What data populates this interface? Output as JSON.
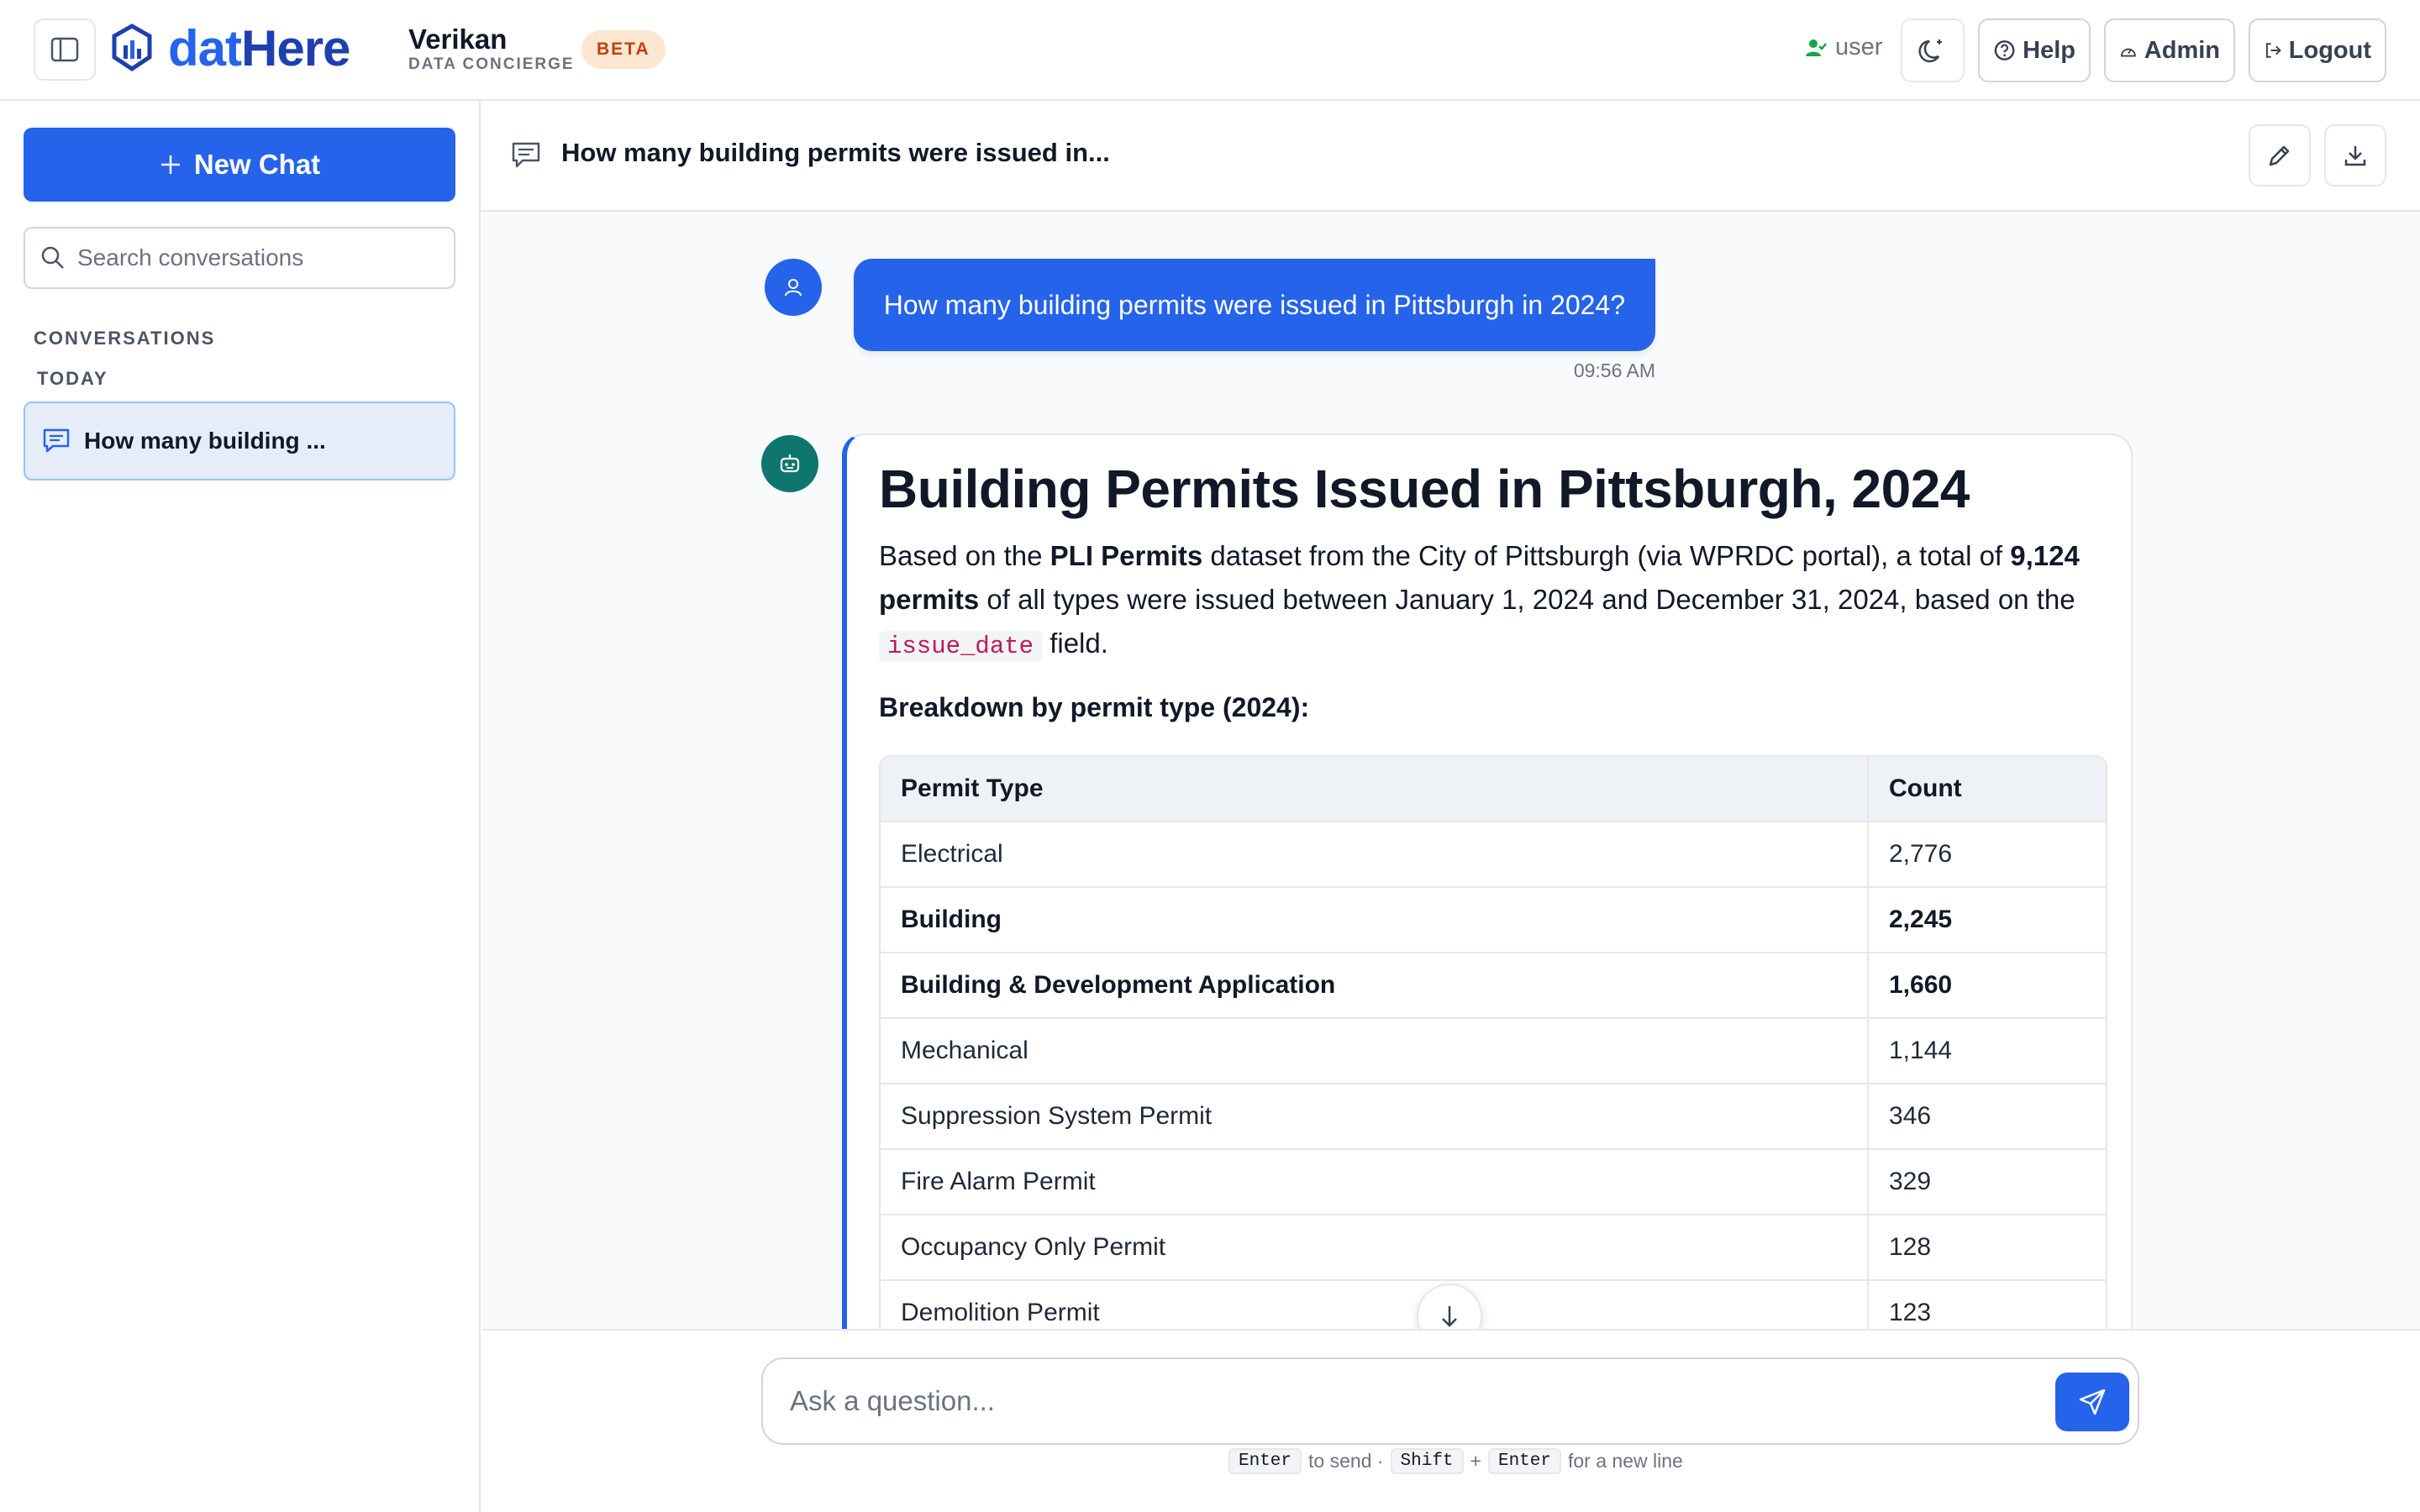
{
  "header": {
    "brand_part1": "dat",
    "brand_part2": "Here",
    "org_name": "Verikan",
    "org_subtitle": "DATA CONCIERGE",
    "beta_label": "BETA",
    "user_label": "user",
    "help_label": "Help",
    "admin_label": "Admin",
    "logout_label": "Logout",
    "accent_color": "#2563eb"
  },
  "sidebar": {
    "new_chat_label": "New Chat",
    "search_placeholder": "Search conversations",
    "section_label": "CONVERSATIONS",
    "group_label": "TODAY",
    "conversations": [
      {
        "title": "How many building ...",
        "active": true
      }
    ]
  },
  "conversation": {
    "title": "How many building permits were issued in...",
    "user_message": "How many building permits were issued in Pittsburgh in 2024?",
    "user_time": "09:56 AM",
    "answer": {
      "heading": "Building Permits Issued in Pittsburgh, 2024",
      "intro_1": "Based on the ",
      "intro_dataset": "PLI Permits",
      "intro_2": " dataset from the City of Pittsburgh (via WPRDC portal), a total of ",
      "intro_total": "9,124 permits",
      "intro_3": " of all types were issued between January 1, 2024 and December 31, 2024, based on the ",
      "intro_field": "issue_date",
      "intro_4": " field.",
      "breakdown_heading": "Breakdown by permit type (2024):",
      "table_headers": [
        "Permit Type",
        "Count"
      ],
      "table_rows": [
        [
          "Electrical",
          "2,776"
        ],
        [
          "Building",
          "2,245"
        ],
        [
          "Building & Development Application",
          "1,660"
        ],
        [
          "Mechanical",
          "1,144"
        ],
        [
          "Suppression System Permit",
          "346"
        ],
        [
          "Fire Alarm Permit",
          "329"
        ],
        [
          "Occupancy Only Permit",
          "128"
        ],
        [
          "Demolition Permit",
          "123"
        ]
      ]
    }
  },
  "composer": {
    "placeholder": "Ask a question...",
    "hint_key_enter": "Enter",
    "hint_send": "to send ·",
    "hint_key_shift": "Shift",
    "hint_plus": "+",
    "hint_key_enter2": "Enter",
    "hint_newline": "for a new line"
  }
}
